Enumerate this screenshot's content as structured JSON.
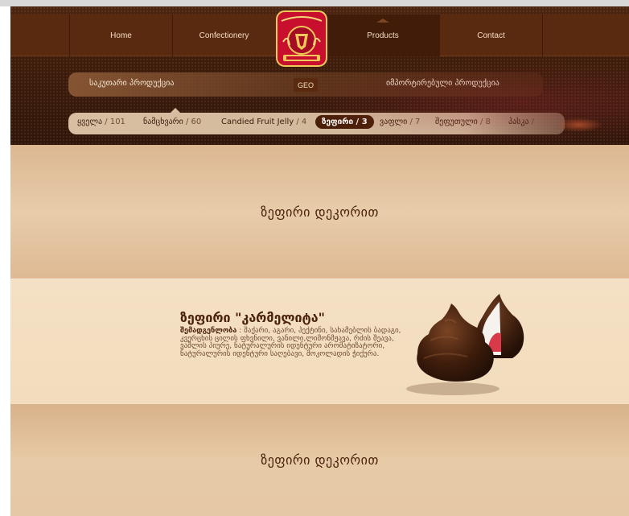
{
  "nav": {
    "home": "Home",
    "confectionery": "Confectionery",
    "products": "Products",
    "contact": "Contact"
  },
  "subnav": {
    "own_products": "საკუთარი პროდუქცია",
    "lang": "GEO",
    "imported_products": "იმპორტირებული პროდუქცია"
  },
  "filters": [
    {
      "label": "ყველა",
      "count": " / 101"
    },
    {
      "label": "ნამცხვარი",
      "count": " / 60"
    },
    {
      "label": "Candied Fruit Jelly",
      "count": " / 4"
    },
    {
      "label": "ზეფირი / 3",
      "count": ""
    },
    {
      "label": "ვაფლი",
      "count": " / 7"
    },
    {
      "label": "შეფუთული",
      "count": " / 8"
    },
    {
      "label": "პასკა",
      "count": " /"
    }
  ],
  "sections": {
    "top_title": "ზეფირი დეკორით",
    "bottom_title": "ზეფირი დეკორით"
  },
  "product": {
    "title": "ზეფირი \"კარმელიტა\"",
    "ingredients_label": "შემადგენლობა",
    "ingredients_text": " : შაქარი, აგარი, პექტინი, სახამებლის ბადაგი, კვერცხის ცილის ფხვნილი, ვანილი,ლიმონმჟავა, რძის შეავა, ვაშლის პიურე, ნატურალურის იდენტური არომატიზატორი, ნატურალურის იდენტური საღებავი, შოკოლადის ჭიქურა."
  },
  "colors": {
    "header_brown": "#4c230e",
    "nav_active": "#411c08",
    "filter_active": "#4a1f08",
    "content_beige": "#e3c29b",
    "product_band": "#f4e0c4",
    "logo_red": "#c8102e"
  }
}
